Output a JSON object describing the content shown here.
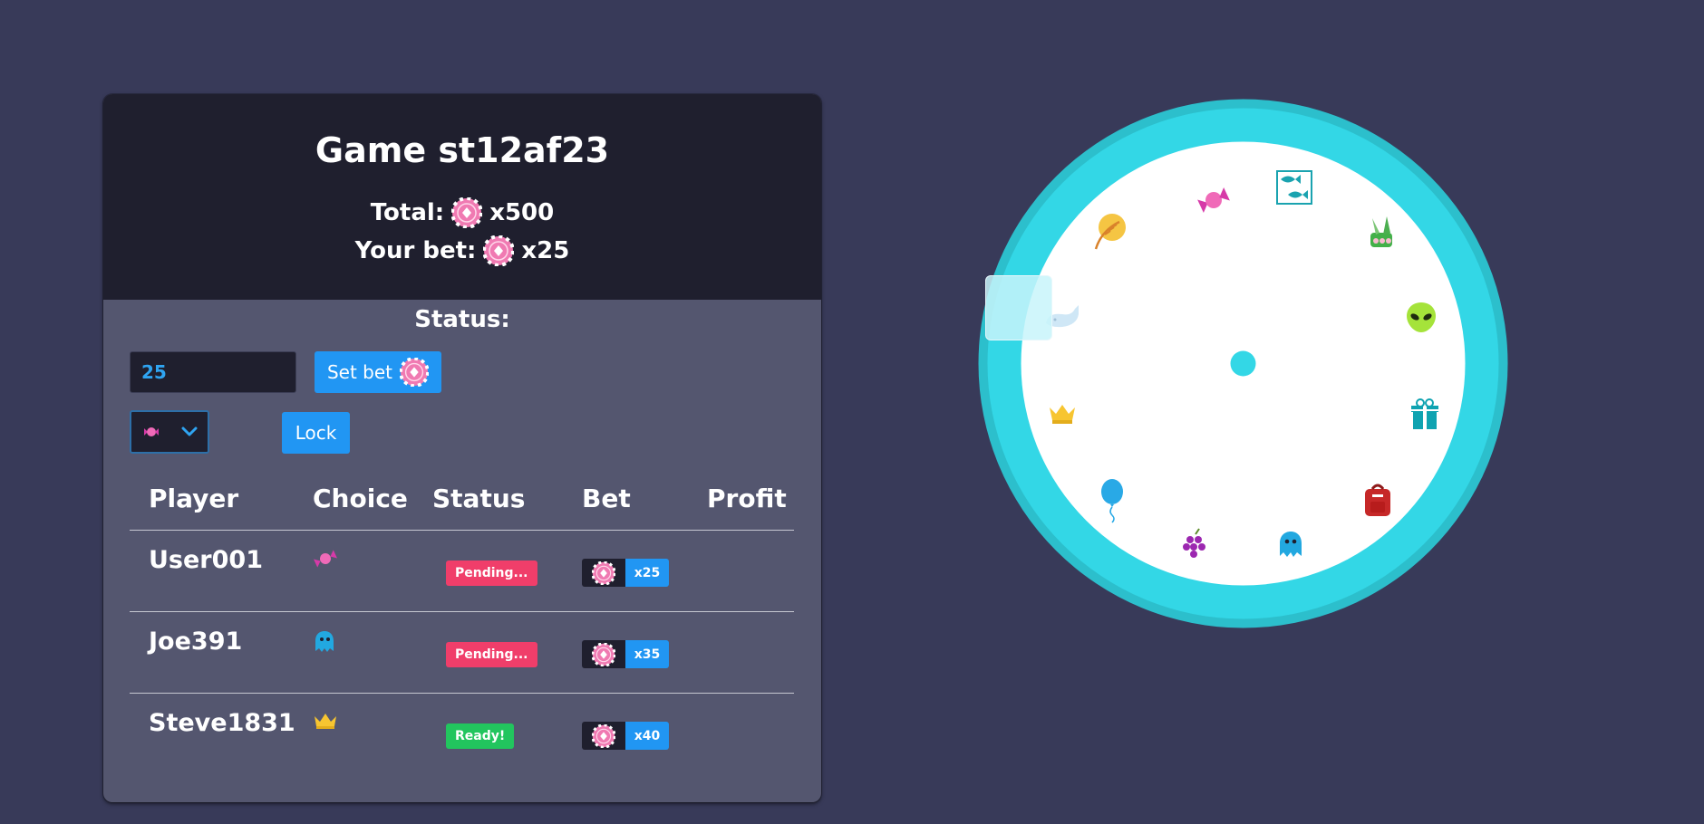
{
  "game": {
    "title": "Game st12af23",
    "total_label": "Total:",
    "total_value": "x500",
    "your_bet_label": "Your bet:",
    "your_bet_value": "x25",
    "status_label": "Status:"
  },
  "controls": {
    "bet_input_value": "25",
    "set_bet_label": "Set bet",
    "selected_choice_icon": "candy-icon",
    "lock_label": "Lock"
  },
  "table": {
    "headers": [
      "Player",
      "Choice",
      "Status",
      "Bet",
      "Profit"
    ],
    "rows": [
      {
        "player": "User001",
        "choice_icon": "candy-icon",
        "status": "Pending...",
        "status_color": "#f03e6a",
        "bet": "x25",
        "profit": ""
      },
      {
        "player": "Joe391",
        "choice_icon": "ghost-icon",
        "status": "Pending...",
        "status_color": "#f03e6a",
        "bet": "x35",
        "profit": ""
      },
      {
        "player": "Steve1831",
        "choice_icon": "crown-icon",
        "status": "Ready!",
        "status_color": "#22c55e",
        "bet": "x40",
        "profit": ""
      }
    ]
  },
  "wheel": {
    "items": [
      "candy-icon",
      "fish-pattern-icon",
      "bamboo-icon",
      "alien-icon",
      "gift-icon",
      "backpack-icon",
      "ghost-icon",
      "grapes-icon",
      "balloon-icon",
      "crown-icon",
      "whale-icon",
      "wheat-coin-icon"
    ],
    "highlighted": "whale-icon"
  },
  "colors": {
    "background": "#383a59",
    "panel": "#54566f",
    "panel_header": "#1f1f2e",
    "accent": "#2196f3",
    "wheel_rim": "#33d7e6",
    "chip": "#f07ab2",
    "pending": "#f03e6a",
    "ready": "#22c55e"
  }
}
